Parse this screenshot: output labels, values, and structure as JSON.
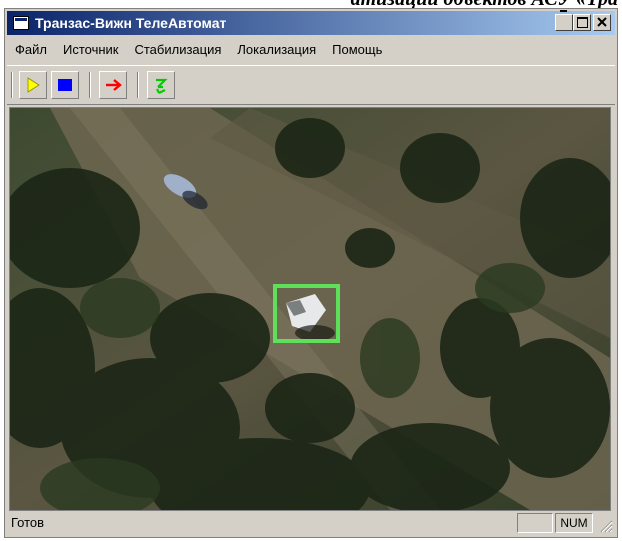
{
  "caption": {
    "text": "атизации объектов АСУ «Тра"
  },
  "window": {
    "title": "Транзас-Вижн ТелеАвтомат"
  },
  "menu": {
    "items": [
      {
        "label": "Файл"
      },
      {
        "label": "Источник"
      },
      {
        "label": "Стабилизация"
      },
      {
        "label": "Локализация"
      },
      {
        "label": "Помощь"
      }
    ]
  },
  "toolbar": {
    "buttons": [
      {
        "icon": "play-icon",
        "color": "#ffff00"
      },
      {
        "icon": "stop-icon",
        "color": "#0000ff"
      },
      {
        "icon": "right-arrow-icon",
        "color": "#ff0000"
      },
      {
        "icon": "stabilize-icon",
        "color": "#00cc00"
      }
    ]
  },
  "video": {
    "tracking_box_color": "#5ee05a"
  },
  "status": {
    "text": "Готов",
    "num_indicator": "NUM"
  }
}
